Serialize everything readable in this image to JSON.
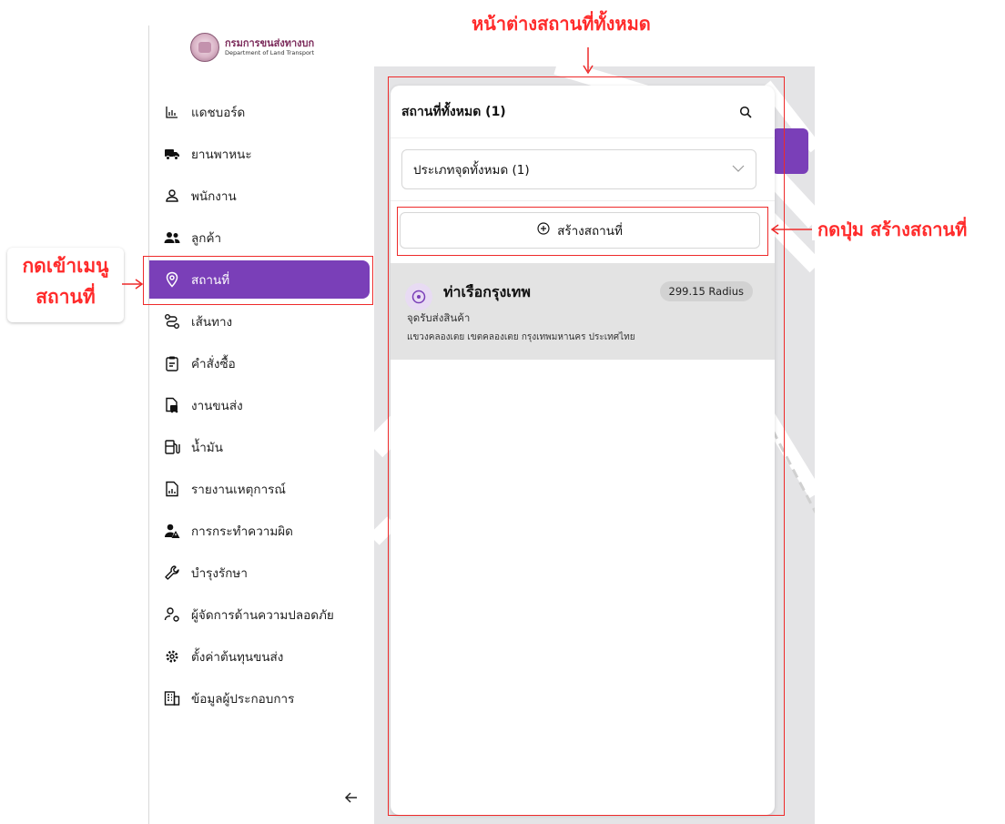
{
  "brand": {
    "name_th": "กรมการขนส่งทางบก",
    "name_en": "Department of Land Transport"
  },
  "sidebar": {
    "items": [
      {
        "label": "แดชบอร์ด",
        "icon": "dashboard-chart-icon"
      },
      {
        "label": "ยานพาหนะ",
        "icon": "truck-icon"
      },
      {
        "label": "พนักงาน",
        "icon": "user-icon"
      },
      {
        "label": "ลูกค้า",
        "icon": "users-icon"
      },
      {
        "label": "สถานที่",
        "icon": "map-pin-icon",
        "active": true
      },
      {
        "label": "เส้นทาง",
        "icon": "route-icon"
      },
      {
        "label": "คำสั่งซื้อ",
        "icon": "clipboard-icon"
      },
      {
        "label": "งานขนส่ง",
        "icon": "delivery-job-icon"
      },
      {
        "label": "น้ำมัน",
        "icon": "fuel-icon"
      },
      {
        "label": "รายงานเหตุการณ์",
        "icon": "report-icon"
      },
      {
        "label": "การกระทำความผิด",
        "icon": "user-warning-icon"
      },
      {
        "label": "บำรุงรักษา",
        "icon": "wrench-icon"
      },
      {
        "label": "ผู้จัดการด้านความปลอดภัย",
        "icon": "safety-manager-icon"
      },
      {
        "label": "ตั้งค่าต้นทุนขนส่ง",
        "icon": "gear-icon"
      },
      {
        "label": "ข้อมูลผู้ประกอบการ",
        "icon": "building-icon"
      }
    ],
    "collapse_icon": "arrow-left-icon"
  },
  "panel": {
    "title": "สถานที่ทั้งหมด (1)",
    "filter_value": "ประเภทจุดทั้งหมด (1)",
    "create_label": "สร้างสถานที่",
    "places": [
      {
        "name": "ท่าเรือกรุงเทพ",
        "radius": "299.15 Radius",
        "type": "จุดรับส่งสินค้า",
        "address": "แขวงคลองเตย เขตคลองเตย กรุงเทพมหานคร ประเทศไทย"
      }
    ]
  },
  "annotations": {
    "panel_label": "หน้าต่างสถานที่ทั้งหมด",
    "create_label": "กดปุ่ม สร้างสถานที่",
    "menu_label_line1": "กดเข้าเมนู",
    "menu_label_line2": "สถานที่"
  },
  "colors": {
    "accent": "#7a3fb8",
    "annotation": "#ee2a2a"
  }
}
